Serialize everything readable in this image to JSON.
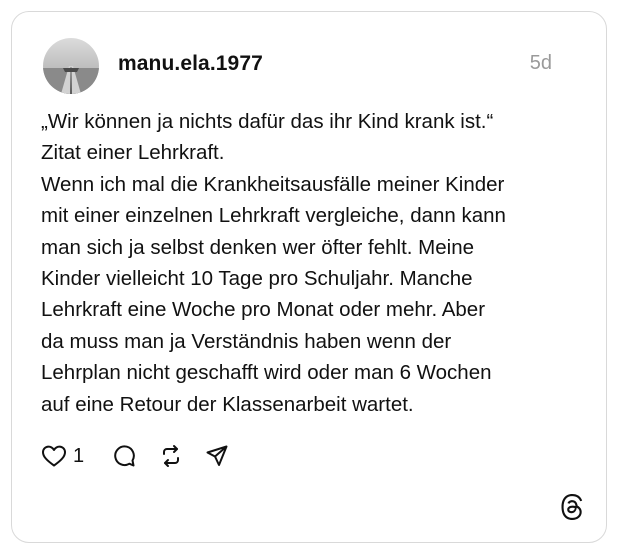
{
  "post": {
    "username": "manu.ela.1977",
    "timestamp": "5d",
    "body_lines": [
      "„Wir können ja nichts dafür das ihr Kind krank ist.“",
      "Zitat einer Lehrkraft.",
      "Wenn ich mal die Krankheitsausfälle meiner Kinder",
      "mit einer einzelnen Lehrkraft vergleiche, dann kann",
      "man sich ja selbst denken wer öfter fehlt. Meine",
      "Kinder vielleicht 10 Tage pro Schuljahr. Manche",
      "Lehrkraft eine Woche pro Monat oder mehr. Aber",
      "da muss man ja Verständnis haben wenn der",
      "Lehrplan nicht geschafft wird oder man 6 Wochen",
      "auf eine Retour der Klassenarbeit wartet."
    ]
  },
  "actions": {
    "like_count": "1",
    "icons": [
      "heart-icon",
      "comment-icon",
      "repost-icon",
      "share-icon"
    ]
  },
  "brand": {
    "logo_icon": "threads-logo-icon"
  },
  "colors": {
    "text": "#111111",
    "muted": "#9a9a9a",
    "border": "#d9d9d9",
    "background": "#ffffff"
  }
}
